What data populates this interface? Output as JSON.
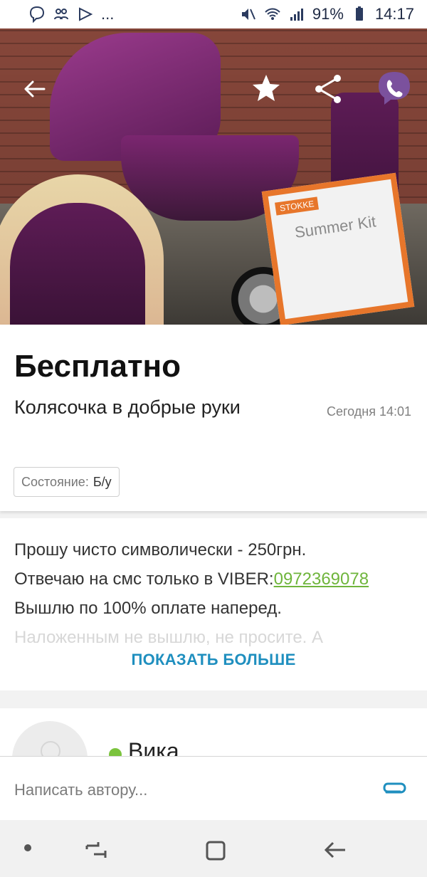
{
  "status_bar": {
    "notification_ellipsis": "...",
    "battery": "91%",
    "time": "14:17",
    "icons": [
      "viber-icon",
      "people-icon",
      "check-icon",
      "mute-icon",
      "wifi-icon",
      "signal-icon",
      "battery-icon"
    ]
  },
  "listing": {
    "image_dots": {
      "total": 7,
      "active_index": 0
    },
    "product_box_brand": "STOKKE",
    "product_box_title": "Summer Kit",
    "price": "Бесплатно",
    "title": "Колясочка в добрые руки",
    "date": "Сегодня 14:01",
    "condition_label": "Состояние:",
    "condition_value": "Б/у"
  },
  "description": {
    "line1": "Прошу чисто символически - 250грн.",
    "line2_text": "Отвечаю на смс только в VIBER:",
    "phone": "0972369078",
    "line3": "Вышлю по 100% оплате наперед.",
    "line4": "Наложенным не вышлю, не просите. А",
    "show_more": "ПОКАЗАТЬ БОЛЬШЕ"
  },
  "author": {
    "name": "Вика",
    "online_color": "#7bc33d"
  },
  "composer": {
    "placeholder": "Написать автору..."
  },
  "colors": {
    "accent": "#1f8fbf",
    "link": "#6fb53c",
    "viber": "#7b519d"
  }
}
